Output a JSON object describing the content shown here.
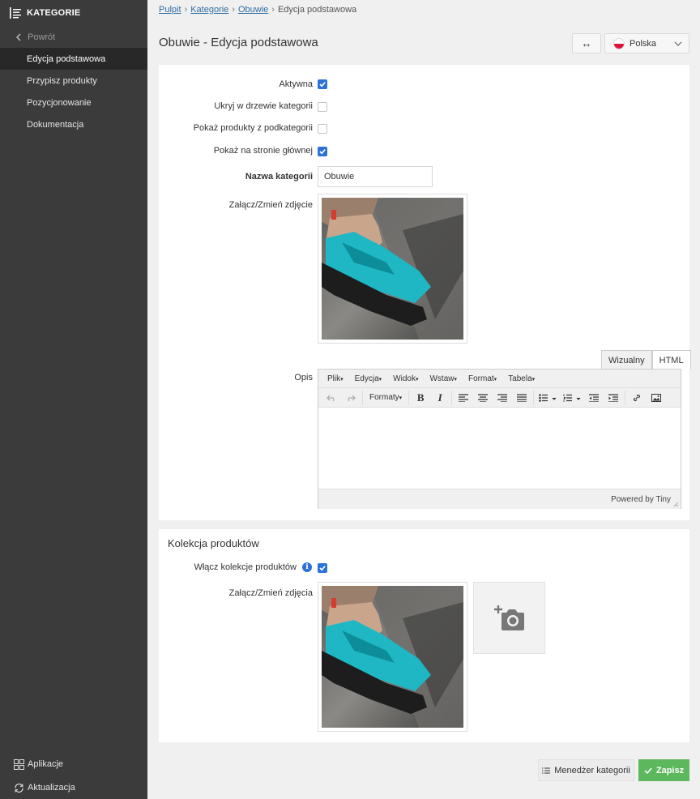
{
  "sidebar": {
    "title": "KATEGORIE",
    "back": "Powrót",
    "items": [
      {
        "label": "Edycja podstawowa"
      },
      {
        "label": "Przypisz produkty"
      },
      {
        "label": "Pozycjonowanie"
      },
      {
        "label": "Dokumentacja"
      }
    ],
    "bottom": [
      {
        "label": "Aplikacje"
      },
      {
        "label": "Aktualizacja"
      }
    ]
  },
  "breadcrumb": [
    "Pulpit",
    "Kategorie",
    "Obuwie",
    "Edycja podstawowa"
  ],
  "page": {
    "title": "Obuwie - Edycja podstawowa",
    "swap_icon": "↔",
    "language": "Polska"
  },
  "form": {
    "active_label": "Aktywna",
    "active": true,
    "hide_label": "Ukryj w drzewie kategorii",
    "hide": false,
    "show_sub_label": "Pokaż produkty z podkategorii",
    "show_sub": false,
    "show_home_label": "Pokaż na stronie głównej",
    "show_home": true,
    "name_label": "Nazwa kategorii",
    "name_value": "Obuwie",
    "image_label": "Załącz/Zmień zdjęcie",
    "desc_label": "Opis"
  },
  "editor": {
    "tabs": [
      "Wizualny",
      "HTML"
    ],
    "menus": [
      "Plik",
      "Edycja",
      "Widok",
      "Wstaw",
      "Format",
      "Tabela"
    ],
    "formats_label": "Formaty",
    "powered": "Powered by Tiny"
  },
  "collection": {
    "title": "Kolekcja produktów",
    "enable_label": "Włącz kolekcje produktów",
    "enabled": true,
    "info": "i",
    "images_label": "Załącz/Zmień zdjęcia"
  },
  "actions": {
    "manager": "Menedżer kategorii",
    "save": "Zapisz"
  },
  "colors": {
    "sidebar_bg": "#3b3b3b",
    "accent": "#2f72d6",
    "save_green": "#5cb85c"
  }
}
